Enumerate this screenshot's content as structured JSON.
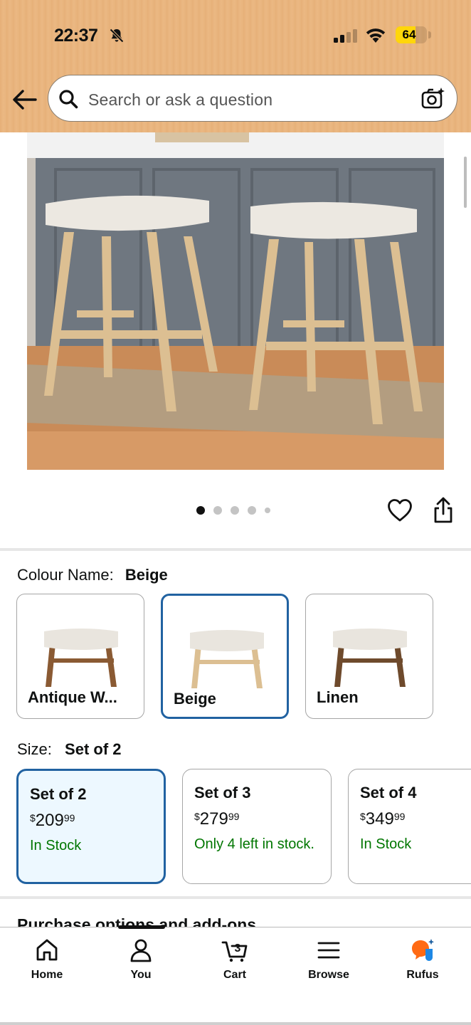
{
  "status_bar": {
    "time": "22:37",
    "battery": "64",
    "battery_level": 0.64,
    "icons": [
      "bell-slash-icon",
      "signal-icon",
      "wifi-icon",
      "battery-icon"
    ]
  },
  "search": {
    "placeholder": "Search or ask a question"
  },
  "gallery": {
    "image_count": 5,
    "active_index": 0
  },
  "colour": {
    "label": "Colour Name:",
    "selected": "Beige",
    "options": [
      {
        "label": "Antique W...",
        "frame_color": "#8a5a33"
      },
      {
        "label": "Beige",
        "frame_color": "#dcbf92"
      },
      {
        "label": "Linen",
        "frame_color": "#6e4a2c"
      }
    ]
  },
  "size": {
    "label": "Size:",
    "selected": "Set of 2",
    "options": [
      {
        "name": "Set of 2",
        "currency": "$",
        "price_whole": "209",
        "price_fraction": "99",
        "stock": "In Stock"
      },
      {
        "name": "Set of 3",
        "currency": "$",
        "price_whole": "279",
        "price_fraction": "99",
        "stock": "Only 4 left in stock."
      },
      {
        "name": "Set of 4",
        "currency": "$",
        "price_whole": "349",
        "price_fraction": "99",
        "stock": "In Stock"
      }
    ]
  },
  "purchase_options_heading": "Purchase options and add-ons",
  "bottom_nav": {
    "items": [
      {
        "label": "Home",
        "icon": "home-icon"
      },
      {
        "label": "You",
        "icon": "person-icon"
      },
      {
        "label": "Cart",
        "icon": "cart-icon",
        "badge": "3"
      },
      {
        "label": "Browse",
        "icon": "menu-icon"
      },
      {
        "label": "Rufus",
        "icon": "rufus-icon"
      }
    ]
  },
  "colors": {
    "accent_blue": "#2162a1",
    "in_stock_green": "#007600",
    "header_bg": "#e8b37c",
    "selected_bg": "#edf8ff",
    "rufus_orange": "#ff6a13"
  }
}
